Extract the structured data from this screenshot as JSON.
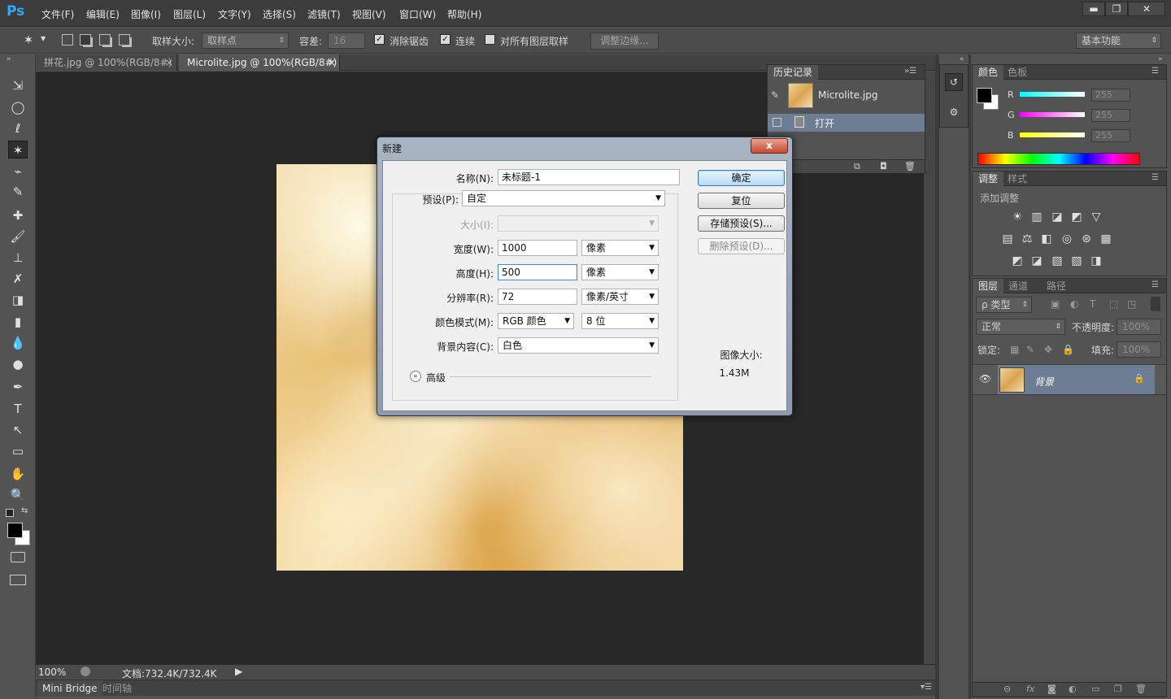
{
  "app": {
    "logo": "Ps",
    "menu": [
      "文件(F)",
      "编辑(E)",
      "图像(I)",
      "图层(L)",
      "文字(Y)",
      "选择(S)",
      "滤镜(T)",
      "视图(V)",
      "窗口(W)",
      "帮助(H)"
    ],
    "window_buttons": [
      "▬",
      "❐",
      "✕"
    ]
  },
  "options": {
    "sample_size_label": "取样大小:",
    "sample_size_value": "取样点",
    "tolerance_label": "容差:",
    "tolerance_value": "16",
    "antialias_label": "消除锯齿",
    "antialias_checked": "✓",
    "contiguous_label": "连续",
    "contiguous_checked": "✓",
    "all_layers_label": "对所有图层取样",
    "refine_edge_label": "调整边缘...",
    "workspace": "基本功能"
  },
  "tabs": [
    {
      "label": "拼花.jpg @ 100%(RGB/8#)",
      "close": "×"
    },
    {
      "label": "Microlite.jpg @ 100%(RGB/8#)",
      "close": "×"
    }
  ],
  "tools": [
    "⇲",
    "◯",
    "ℓ",
    "✶",
    "⌁",
    "✎",
    "✚",
    "🖌",
    "⊥",
    "✗",
    "◨",
    "▮",
    "💧",
    "●",
    "✒",
    "T",
    "↖",
    "▭",
    "✋",
    "🔍"
  ],
  "status": {
    "zoom": "100%",
    "doc_info": "文档:732.4K/732.4K",
    "arrow": "▶"
  },
  "bottom_tabs": [
    "Mini Bridge",
    "时间轴"
  ],
  "history": {
    "tabs": [
      "历史记录"
    ],
    "snapshot_label": "Microlite.jpg",
    "step_label": "打开"
  },
  "color_panel": {
    "tabs": [
      "颜色",
      "色板"
    ],
    "r_label": "R",
    "g_label": "G",
    "b_label": "B",
    "r_value": "255",
    "g_value": "255",
    "b_value": "255"
  },
  "adjust_panel": {
    "tabs": [
      "调整",
      "样式"
    ],
    "add_label": "添加调整",
    "icons_row1": [
      "☀",
      "▥",
      "◪",
      "◩",
      "▽"
    ],
    "icons_row2": [
      "▤",
      "⚖",
      "◧",
      "◎",
      "⊛",
      "▦"
    ],
    "icons_row3": [
      "◩",
      "◪",
      "▨",
      "▧",
      "◨"
    ]
  },
  "layers_panel": {
    "tabs": [
      "图层",
      "通道",
      "路径"
    ],
    "filter_label": "ρ 类型",
    "blend_mode": "正常",
    "opacity_label": "不透明度:",
    "opacity_value": "100%",
    "lock_label": "锁定:",
    "fill_label": "填充:",
    "fill_value": "100%",
    "layer_name": "背景",
    "footer_icons": [
      "⊖",
      "fx",
      "◙",
      "◐",
      "▭",
      "❐",
      "🗑"
    ]
  },
  "dialog": {
    "title": "新建",
    "close": "x",
    "name_label": "名称(N):",
    "name_value": "未标题-1",
    "preset_label": "预设(P):",
    "preset_value": "自定",
    "size_label": "大小(I):",
    "width_label": "宽度(W):",
    "width_value": "1000",
    "width_unit": "像素",
    "height_label": "高度(H):",
    "height_value": "500",
    "height_unit": "像素",
    "resolution_label": "分辨率(R):",
    "resolution_value": "72",
    "resolution_unit": "像素/英寸",
    "color_mode_label": "颜色模式(M):",
    "color_mode_value": "RGB 颜色",
    "bit_depth_value": "8 位",
    "background_label": "背景内容(C):",
    "background_value": "白色",
    "advanced_label": "高级",
    "ok_button": "确定",
    "reset_button": "复位",
    "save_preset_button": "存储预设(S)...",
    "delete_preset_button": "删除预设(D)...",
    "image_size_label": "图像大小:",
    "image_size_value": "1.43M"
  }
}
